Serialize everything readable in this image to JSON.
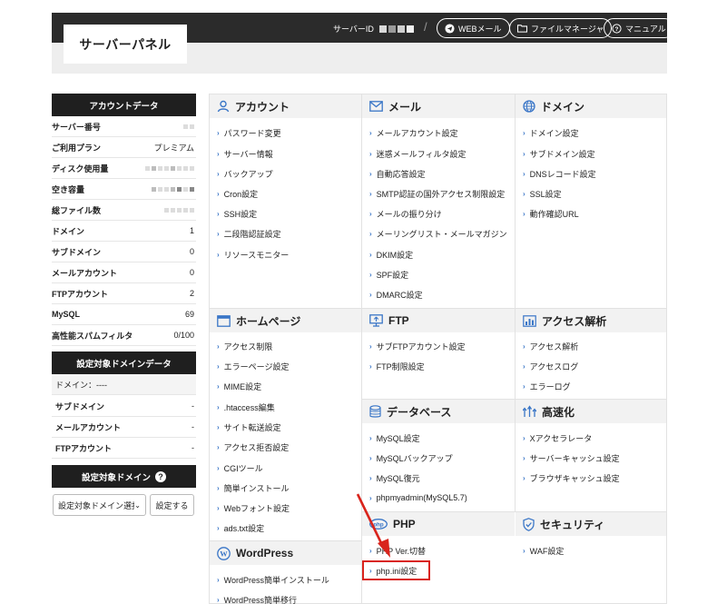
{
  "header": {
    "brand": "サーバーパネル",
    "server_id_label": "サーバーID",
    "separator": "/",
    "buttons": {
      "webmail": "WEBメール",
      "file_manager": "ファイルマネージャ",
      "manual": "マニュアル"
    }
  },
  "sidebar": {
    "account_title": "アカウントデータ",
    "account_rows": [
      {
        "label": "サーバー番号",
        "value": ""
      },
      {
        "label": "ご利用プラン",
        "value": "プレミアム"
      },
      {
        "label": "ディスク使用量",
        "value": ""
      },
      {
        "label": "空き容量",
        "value": ""
      },
      {
        "label": "総ファイル数",
        "value": ""
      },
      {
        "label": "ドメイン",
        "value": "1"
      },
      {
        "label": "サブドメイン",
        "value": "0"
      },
      {
        "label": "メールアカウント",
        "value": "0"
      },
      {
        "label": "FTPアカウント",
        "value": "2"
      },
      {
        "label": "MySQL",
        "value": "69"
      },
      {
        "label": "高性能スパムフィルタ",
        "value": "0/100"
      }
    ],
    "domain_data_title": "設定対象ドメインデータ",
    "domain_rows": [
      {
        "label": "ドメイン：----",
        "value": ""
      },
      {
        "label": "サブドメイン",
        "value": "-"
      },
      {
        "label": "メールアカウント",
        "value": "-"
      },
      {
        "label": "FTPアカウント",
        "value": "-"
      }
    ],
    "target_domain_title": "設定対象ドメイン",
    "target_domain_select": "設定対象ドメイン選択",
    "set_button": "設定する"
  },
  "sections": {
    "account": {
      "title": "アカウント",
      "items": [
        "パスワード変更",
        "サーバー情報",
        "バックアップ",
        "Cron設定",
        "SSH設定",
        "二段階認証設定",
        "リソースモニター"
      ]
    },
    "mail": {
      "title": "メール",
      "items": [
        "メールアカウント設定",
        "迷惑メールフィルタ設定",
        "自動応答設定",
        "SMTP認証の国外アクセス制限設定",
        "メールの振り分け",
        "メーリングリスト・メールマガジン",
        "DKIM設定",
        "SPF設定",
        "DMARC設定"
      ]
    },
    "domain": {
      "title": "ドメイン",
      "items": [
        "ドメイン設定",
        "サブドメイン設定",
        "DNSレコード設定",
        "SSL設定",
        "動作確認URL"
      ]
    },
    "homepage": {
      "title": "ホームページ",
      "items": [
        "アクセス制限",
        "エラーページ設定",
        "MIME設定",
        ".htaccess編集",
        "サイト転送設定",
        "アクセス拒否設定",
        "CGIツール",
        "簡単インストール",
        "Webフォント設定",
        "ads.txt設定"
      ]
    },
    "ftp": {
      "title": "FTP",
      "items": [
        "サブFTPアカウント設定",
        "FTP制限設定"
      ]
    },
    "analytics": {
      "title": "アクセス解析",
      "items": [
        "アクセス解析",
        "アクセスログ",
        "エラーログ"
      ]
    },
    "database": {
      "title": "データベース",
      "items": [
        "MySQL設定",
        "MySQLバックアップ",
        "MySQL復元",
        "phpmyadmin(MySQL5.7)"
      ]
    },
    "speed": {
      "title": "高速化",
      "items": [
        "Xアクセラレータ",
        "サーバーキャッシュ設定",
        "ブラウザキャッシュ設定"
      ]
    },
    "php": {
      "title": "PHP",
      "items": [
        "PHP Ver.切替",
        "php.ini設定"
      ]
    },
    "security": {
      "title": "セキュリティ",
      "items": [
        "WAF設定"
      ]
    },
    "wordpress": {
      "title": "WordPress",
      "items": [
        "WordPress簡単インストール",
        "WordPress簡単移行"
      ]
    }
  },
  "icons": {
    "account": "user-icon",
    "mail": "envelope-icon",
    "domain": "globe-icon",
    "homepage": "browser-window-icon",
    "ftp": "monitor-upload-icon",
    "analytics": "bar-chart-icon",
    "database": "database-icon",
    "speed": "speed-arrows-icon",
    "php": "php-logo-icon",
    "security": "shield-check-icon",
    "wordpress": "wordpress-logo-icon"
  },
  "colors": {
    "accent_blue": "#3a76c7",
    "header_dark": "#2b2b2b",
    "sidebar_dark": "#1f1f1f",
    "highlight_red": "#d9241c"
  }
}
